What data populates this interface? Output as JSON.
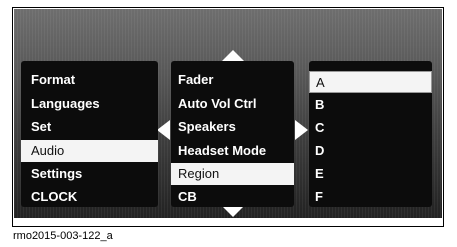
{
  "left_menu": {
    "items": [
      {
        "label": "Format",
        "selected": false
      },
      {
        "label": "Languages",
        "selected": false
      },
      {
        "label": "Set",
        "selected": false
      },
      {
        "label": "Audio",
        "selected": true
      },
      {
        "label": "Settings",
        "selected": false
      },
      {
        "label": "CLOCK",
        "selected": false
      }
    ]
  },
  "middle_menu": {
    "items": [
      {
        "label": "Fader",
        "selected": false
      },
      {
        "label": "Auto Vol Ctrl",
        "selected": false
      },
      {
        "label": "Speakers",
        "selected": false
      },
      {
        "label": "Headset Mode",
        "selected": false
      },
      {
        "label": "Region",
        "selected": true
      },
      {
        "label": "CB",
        "selected": false
      }
    ]
  },
  "right_menu": {
    "items": [
      {
        "label": "A",
        "selected": true
      },
      {
        "label": "B",
        "selected": false
      },
      {
        "label": "C",
        "selected": false
      },
      {
        "label": "D",
        "selected": false
      },
      {
        "label": "E",
        "selected": false
      },
      {
        "label": "F",
        "selected": false
      }
    ]
  },
  "caption": "rmo2015-003-122_a",
  "icons": {
    "up": "arrow-up-icon",
    "down": "arrow-down-icon",
    "left": "arrow-left-icon",
    "right": "arrow-right-icon"
  }
}
